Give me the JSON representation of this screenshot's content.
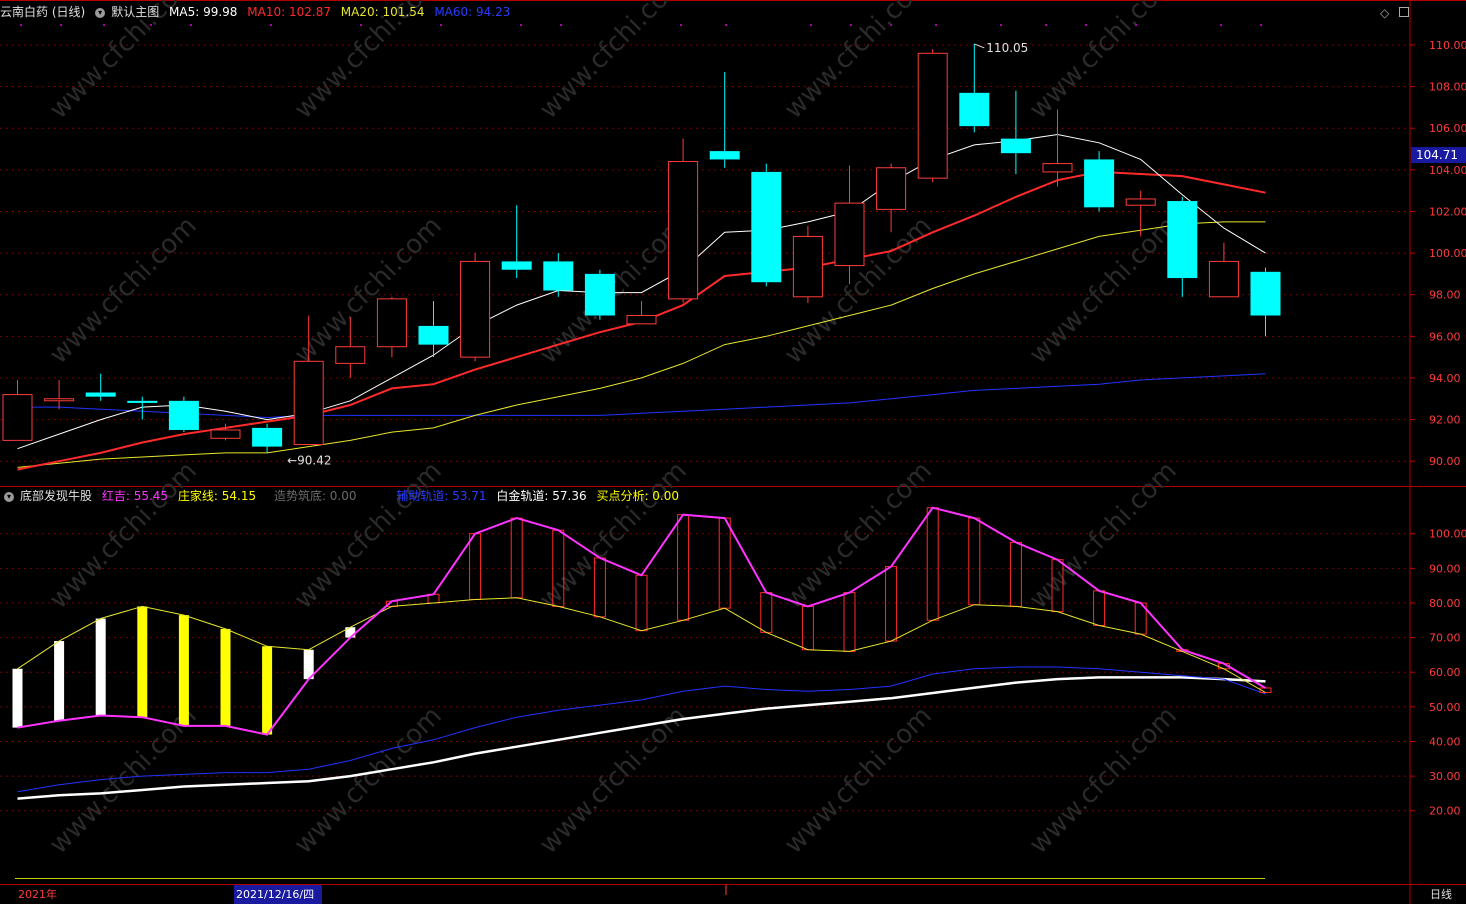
{
  "header_main": {
    "stock_title": "云南白药 (日线)",
    "template": "默认主图",
    "ma5_label": "MA5: 99.98",
    "ma10_label": "MA10: 102.87",
    "ma20_label": "MA20: 101.54",
    "ma60_label": "MA60: 94.23"
  },
  "header_sub": {
    "indicator_name": "底部发现牛股",
    "red_xi_label": "红吉: 55.45",
    "zhuangjia_label": "庄家线: 54.15",
    "zaoshi_label": "造势筑底: 0.00",
    "fuzhu_label": "辅助轨道: 53.71",
    "baijin_label": "白金轨道: 57.36",
    "maidian_label": "买点分析: 0.00"
  },
  "footer": {
    "year_label": "2021年",
    "cursor_date": "2021/12/16/四",
    "period_label": "日线"
  },
  "watermark": "www.cfchi.com",
  "colors": {
    "up": "#ff3b3b",
    "down": "#00ffff",
    "ma5": "#ffffff",
    "ma10": "#ff2a2a",
    "ma20": "#e6e62e",
    "ma60": "#2233ff",
    "magenta": "#ff33ff",
    "yellow": "#ffff00",
    "grid": "#7a0000"
  },
  "chart_data": [
    {
      "type": "candlestick",
      "title": "云南白药 (日线)",
      "y_axis_ticks": [
        90,
        92,
        94,
        96,
        98,
        100,
        102,
        104,
        106,
        108,
        110
      ],
      "ylim": [
        89,
        111.2
      ],
      "current_price_label": "104.71",
      "high_annotation": "110.05",
      "low_annotation": "90.42",
      "candles": [
        {
          "o": 91.0,
          "c": 93.2,
          "h": 93.9,
          "l": 91.0
        },
        {
          "o": 93.0,
          "c": 93.0,
          "h": 93.9,
          "l": 92.5
        },
        {
          "o": 93.3,
          "c": 93.1,
          "h": 94.2,
          "l": 92.9
        },
        {
          "o": 92.9,
          "c": 92.8,
          "h": 93.1,
          "l": 92.0
        },
        {
          "o": 92.9,
          "c": 91.5,
          "h": 93.1,
          "l": 91.4
        },
        {
          "o": 91.1,
          "c": 91.5,
          "h": 91.8,
          "l": 91.0
        },
        {
          "o": 91.6,
          "c": 90.7,
          "h": 91.8,
          "l": 90.42
        },
        {
          "o": 90.8,
          "c": 94.8,
          "h": 97.0,
          "l": 90.8
        },
        {
          "o": 94.7,
          "c": 95.5,
          "h": 96.9,
          "l": 94.0
        },
        {
          "o": 95.5,
          "c": 97.8,
          "h": 97.9,
          "l": 95.0
        },
        {
          "o": 96.5,
          "c": 95.6,
          "h": 97.7,
          "l": 95.0
        },
        {
          "o": 95.0,
          "c": 99.6,
          "h": 100.0,
          "l": 94.8
        },
        {
          "o": 99.6,
          "c": 99.2,
          "h": 102.3,
          "l": 98.8
        },
        {
          "o": 99.6,
          "c": 98.2,
          "h": 100.0,
          "l": 97.9
        },
        {
          "o": 99.0,
          "c": 97.0,
          "h": 99.2,
          "l": 96.8
        },
        {
          "o": 96.6,
          "c": 97.0,
          "h": 97.7,
          "l": 96.6
        },
        {
          "o": 97.8,
          "c": 104.4,
          "h": 105.5,
          "l": 97.6
        },
        {
          "o": 104.9,
          "c": 104.5,
          "h": 108.7,
          "l": 104.1
        },
        {
          "o": 103.9,
          "c": 98.6,
          "h": 104.3,
          "l": 98.4
        },
        {
          "o": 97.9,
          "c": 100.8,
          "h": 101.3,
          "l": 97.6
        },
        {
          "o": 99.4,
          "c": 102.4,
          "h": 104.2,
          "l": 98.5
        },
        {
          "o": 102.1,
          "c": 104.1,
          "h": 104.3,
          "l": 101.0
        },
        {
          "o": 103.6,
          "c": 109.6,
          "h": 109.8,
          "l": 103.4
        },
        {
          "o": 107.7,
          "c": 106.1,
          "h": 110.05,
          "l": 105.8
        },
        {
          "o": 105.5,
          "c": 104.8,
          "h": 107.8,
          "l": 103.8
        },
        {
          "o": 103.9,
          "c": 104.3,
          "h": 106.9,
          "l": 103.2
        },
        {
          "o": 104.5,
          "c": 102.2,
          "h": 104.9,
          "l": 102.0
        },
        {
          "o": 102.3,
          "c": 102.6,
          "h": 103.0,
          "l": 100.8
        },
        {
          "o": 102.5,
          "c": 98.8,
          "h": 102.7,
          "l": 97.9
        },
        {
          "o": 97.9,
          "c": 99.6,
          "h": 100.5,
          "l": 97.9
        },
        {
          "o": 99.1,
          "c": 97.0,
          "h": 99.3,
          "l": 96.0
        }
      ],
      "ma5": [
        90.6,
        91.3,
        92.0,
        92.6,
        92.7,
        92.4,
        92.0,
        92.3,
        92.9,
        94.0,
        95.1,
        96.5,
        97.5,
        98.2,
        98.1,
        98.1,
        99.2,
        101.0,
        101.1,
        101.5,
        102.0,
        103.4,
        104.5,
        105.2,
        105.4,
        105.7,
        105.3,
        104.5,
        102.8,
        101.2,
        100.0
      ],
      "ma10": [
        89.6,
        90.0,
        90.4,
        90.9,
        91.3,
        91.6,
        91.9,
        92.2,
        92.7,
        93.5,
        93.7,
        94.4,
        95.0,
        95.6,
        96.2,
        96.7,
        97.5,
        98.9,
        99.1,
        99.3,
        99.7,
        100.1,
        101.0,
        101.8,
        102.7,
        103.5,
        103.9,
        103.8,
        103.7,
        103.3,
        102.9
      ],
      "ma20": [
        89.7,
        89.9,
        90.1,
        90.2,
        90.3,
        90.4,
        90.4,
        90.7,
        91.0,
        91.4,
        91.6,
        92.2,
        92.7,
        93.1,
        93.5,
        94.0,
        94.7,
        95.6,
        96.0,
        96.5,
        97.0,
        97.5,
        98.3,
        99.0,
        99.6,
        100.2,
        100.8,
        101.1,
        101.4,
        101.5,
        101.5
      ],
      "ma60": [
        92.6,
        92.6,
        92.5,
        92.4,
        92.3,
        92.2,
        92.1,
        92.2,
        92.2,
        92.2,
        92.2,
        92.2,
        92.2,
        92.2,
        92.2,
        92.3,
        92.4,
        92.5,
        92.6,
        92.7,
        92.8,
        93.0,
        93.2,
        93.4,
        93.5,
        93.6,
        93.7,
        93.9,
        94.0,
        94.1,
        94.2
      ]
    },
    {
      "type": "indicator",
      "title": "底部发现牛股",
      "y_axis_ticks": [
        20,
        30,
        40,
        50,
        60,
        70,
        80,
        90,
        100
      ],
      "ylim": [
        0,
        108
      ],
      "red_xi": [
        44.0,
        46.0,
        47.5,
        47.0,
        44.5,
        44.5,
        42.0,
        58.0,
        70.0,
        80.5,
        82.5,
        100.0,
        104.5,
        101.0,
        93.0,
        88.0,
        105.5,
        104.5,
        83.0,
        79.0,
        83.0,
        90.5,
        107.5,
        104.5,
        97.5,
        92.5,
        83.5,
        80.0,
        66.5,
        62.5,
        55.45
      ],
      "zhuangjia": [
        61.0,
        69.0,
        75.5,
        79.0,
        76.5,
        72.5,
        67.5,
        66.5,
        73.0,
        79.0,
        80.0,
        81.0,
        81.5,
        79.0,
        76.0,
        72.0,
        75.0,
        78.5,
        71.5,
        66.5,
        66.0,
        69.0,
        75.0,
        79.5,
        79.0,
        77.5,
        73.5,
        71.0,
        66.0,
        61.0,
        54.15
      ],
      "fuzhu": [
        25.5,
        27.5,
        29.0,
        30.0,
        30.5,
        31.0,
        31.0,
        32.0,
        34.5,
        38.0,
        40.5,
        44.0,
        47.0,
        49.0,
        50.5,
        52.0,
        54.5,
        56.0,
        55.0,
        54.5,
        55.0,
        56.0,
        59.5,
        61.0,
        61.5,
        61.5,
        61.0,
        60.0,
        59.0,
        58.0,
        53.71
      ],
      "baijin": [
        23.5,
        24.5,
        25.0,
        26.0,
        27.0,
        27.5,
        28.0,
        28.5,
        30.0,
        32.0,
        34.0,
        36.5,
        38.5,
        40.5,
        42.5,
        44.5,
        46.5,
        48.0,
        49.5,
        50.5,
        51.5,
        52.5,
        54.0,
        55.5,
        57.0,
        58.0,
        58.5,
        58.5,
        58.5,
        58.0,
        57.36
      ],
      "bar_colors": [
        "white",
        "white",
        "white",
        "yellow",
        "yellow",
        "yellow",
        "yellow",
        "white",
        "white",
        "red",
        "red",
        "red",
        "red",
        "red",
        "red",
        "red",
        "red",
        "red",
        "red",
        "red",
        "red",
        "red",
        "red",
        "red",
        "red",
        "red",
        "red",
        "red",
        "red",
        "red",
        "red"
      ]
    }
  ]
}
